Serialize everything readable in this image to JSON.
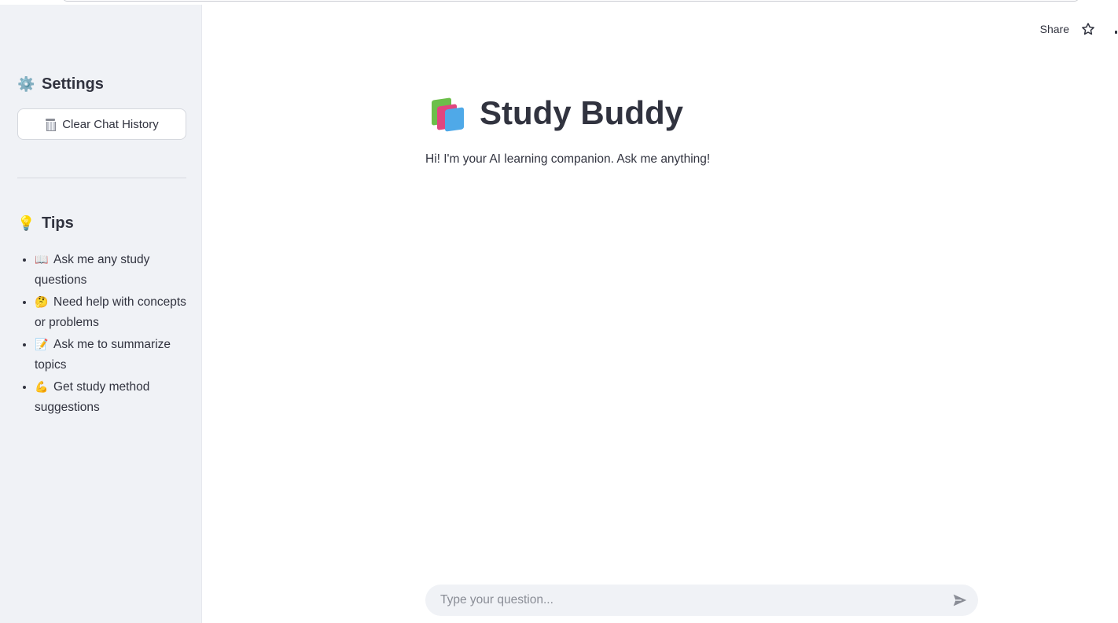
{
  "sidebar": {
    "settings_icon": "⚙️",
    "settings_title": "Settings",
    "clear_button_label": "Clear Chat History",
    "clear_button_icon": "wastebasket-icon",
    "tips_icon": "💡",
    "tips_title": "Tips",
    "tips": [
      {
        "icon": "📖",
        "text": "Ask me any study questions"
      },
      {
        "icon": "🤔",
        "text": "Need help with concepts or problems"
      },
      {
        "icon": "📝",
        "text": "Ask me to summarize topics"
      },
      {
        "icon": "💪",
        "text": "Get study method suggestions"
      }
    ]
  },
  "header": {
    "share_label": "Share",
    "star_icon": "star-icon"
  },
  "main": {
    "title_icon": "books-icon",
    "title": "Study Buddy",
    "subtitle": "Hi! I'm your AI learning companion. Ask me anything!"
  },
  "chat_input": {
    "placeholder": "Type your question...",
    "value": "",
    "send_icon": "send-icon"
  },
  "colors": {
    "sidebar_bg": "#f0f2f6",
    "text": "#31333f",
    "input_bg": "#f0f2f6"
  }
}
